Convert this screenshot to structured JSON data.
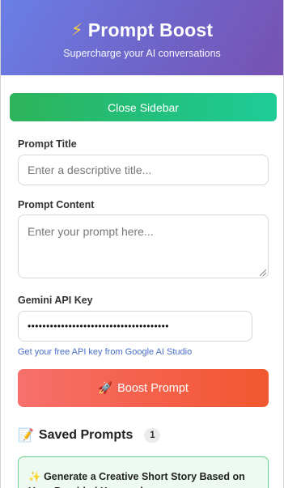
{
  "header": {
    "icon": "lightning-bolt-icon",
    "bolt_glyph": "⚡",
    "title": "Prompt Boost",
    "subtitle": "Supercharge your AI conversations"
  },
  "actions": {
    "close_sidebar": "Close Sidebar",
    "boost_icon": "rocket-icon",
    "boost_glyph": "🚀",
    "boost_label": "Boost Prompt"
  },
  "form": {
    "title_label": "Prompt Title",
    "title_placeholder": "Enter a descriptive title...",
    "content_label": "Prompt Content",
    "content_placeholder": "Enter your prompt here...",
    "api_key_label": "Gemini API Key",
    "api_key_value": "••••••••••••••••••••••••••••••••••••••",
    "api_key_link": "Get your free API key from Google AI Studio"
  },
  "saved": {
    "icon": "memo-icon",
    "glyph": "📝",
    "heading": "Saved Prompts",
    "count": "1",
    "items": [
      {
        "icon": "sparkles-icon",
        "glyph": "✨",
        "title": "Generate a Creative Short Story Based on User-Provided Keywords"
      }
    ]
  },
  "colors": {
    "header_start": "#6a7fe6",
    "header_end": "#7652b3",
    "close_button": "#2eb35a",
    "boost_button": "#f46049",
    "link": "#4a6fc8",
    "card_border": "#6fcf8f"
  }
}
